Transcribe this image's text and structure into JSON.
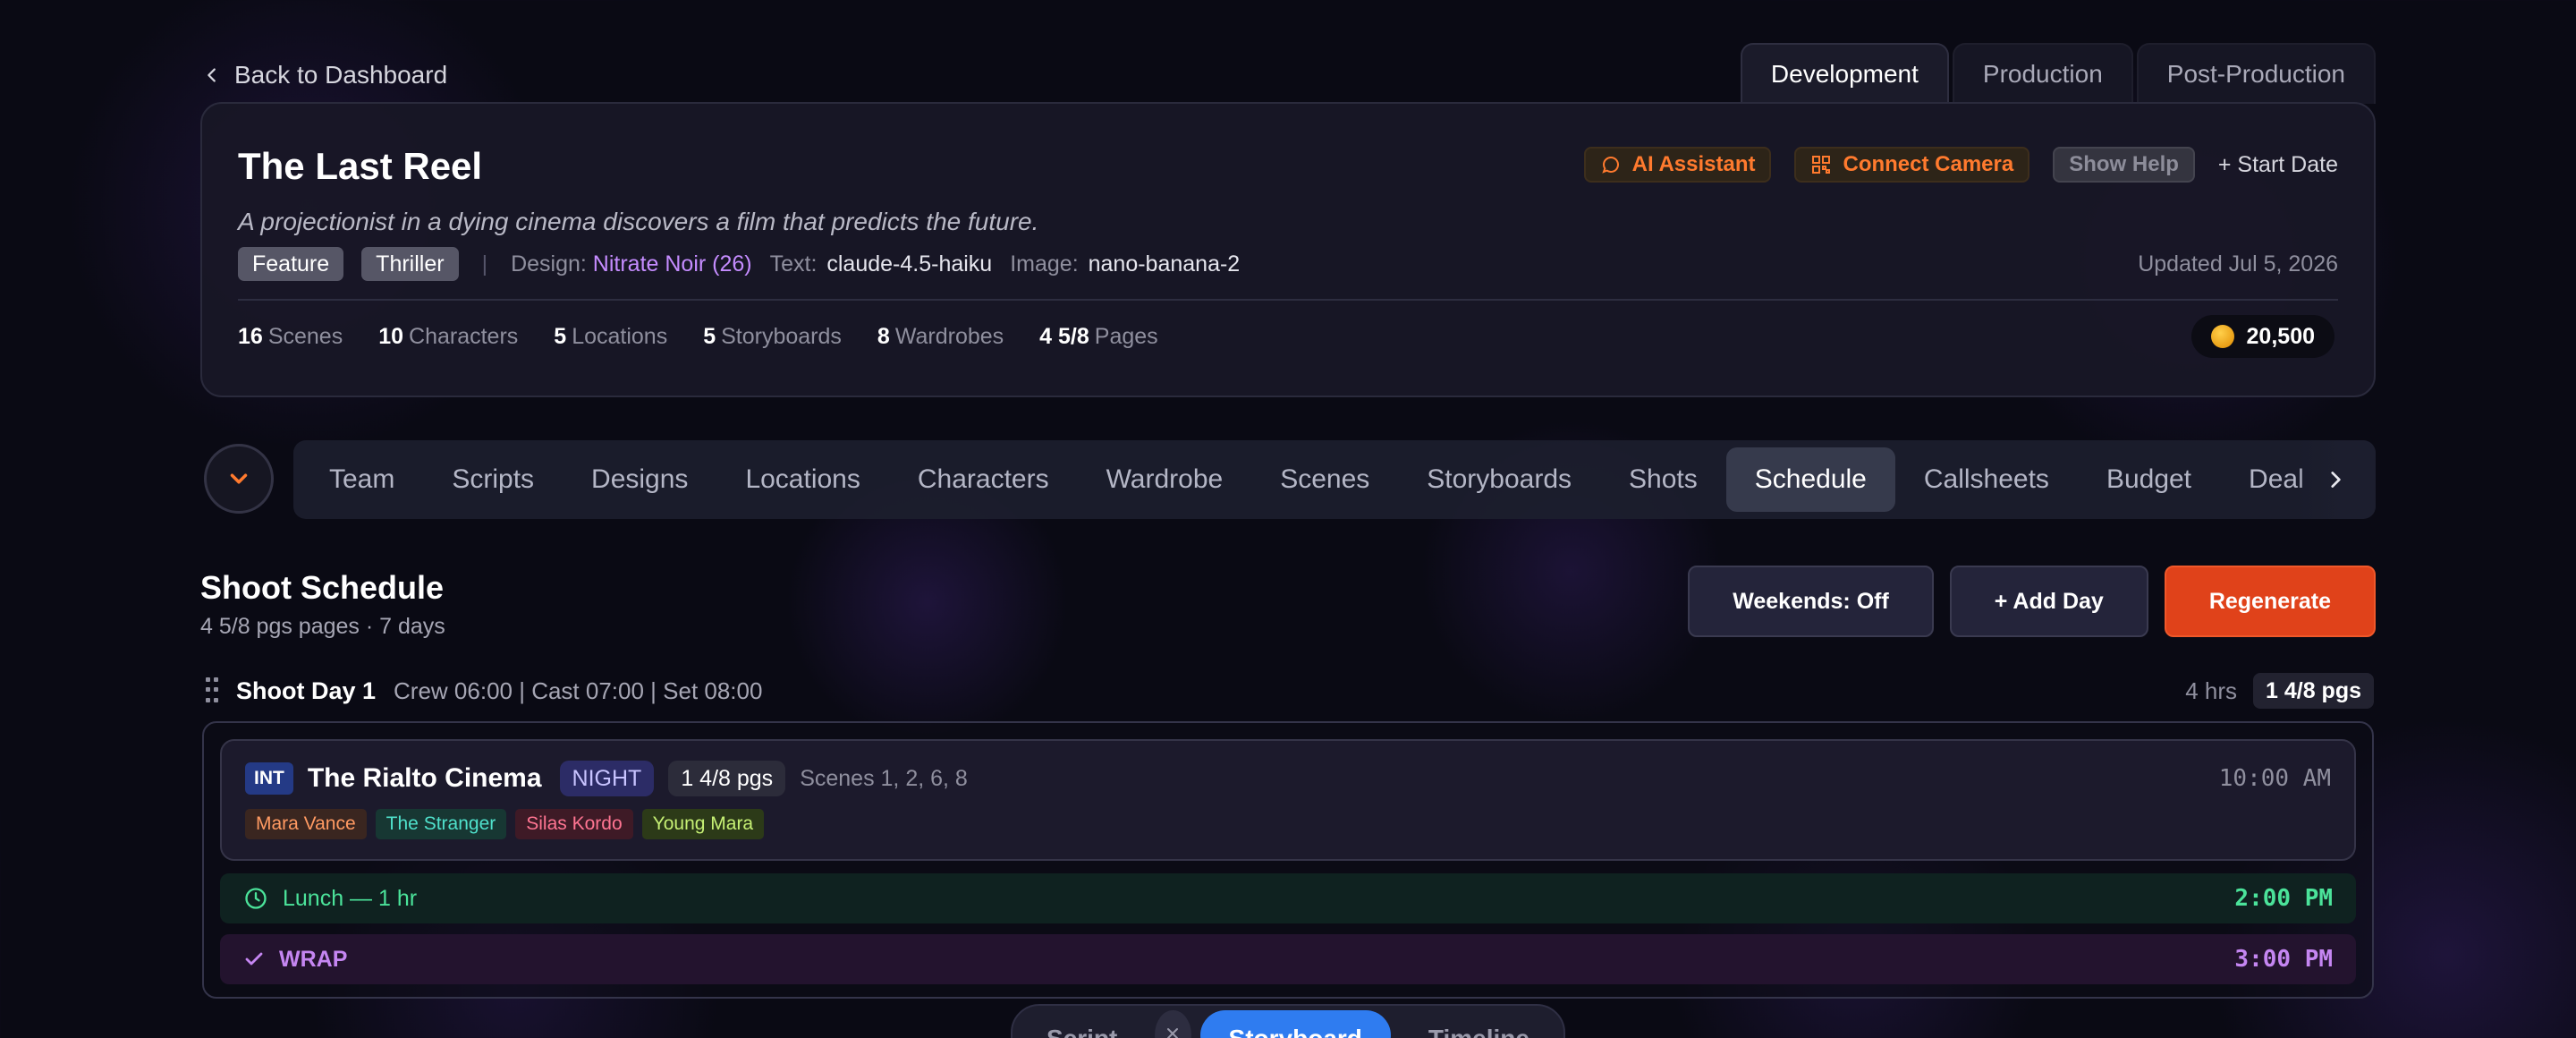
{
  "back": {
    "label": "Back to Dashboard"
  },
  "phase_tabs": [
    {
      "label": "Development",
      "active": true
    },
    {
      "label": "Production",
      "active": false
    },
    {
      "label": "Post-Production",
      "active": false
    }
  ],
  "project": {
    "title": "The Last Reel",
    "logline": "A projectionist in a dying cinema discovers a film that predicts the future.",
    "tags": [
      "Feature",
      "Thriller"
    ],
    "design_label": "Design:",
    "design_value": "Nitrate Noir (26)",
    "text_label": "Text:",
    "text_value": "claude-4.5-haiku",
    "image_label": "Image:",
    "image_value": "nano-banana-2",
    "updated": "Updated Jul 5, 2026",
    "actions": {
      "ai_assistant": "AI Assistant",
      "connect_camera": "Connect Camera",
      "show_help": "Show Help",
      "start_date": "+ Start Date"
    },
    "stats": [
      {
        "value": "16",
        "label": "Scenes"
      },
      {
        "value": "10",
        "label": "Characters"
      },
      {
        "value": "5",
        "label": "Locations"
      },
      {
        "value": "5",
        "label": "Storyboards"
      },
      {
        "value": "8",
        "label": "Wardrobes"
      },
      {
        "value": "4 5/8",
        "label": "Pages"
      }
    ],
    "credits": "20,500"
  },
  "section_nav": [
    {
      "label": "Team"
    },
    {
      "label": "Scripts"
    },
    {
      "label": "Designs"
    },
    {
      "label": "Locations"
    },
    {
      "label": "Characters"
    },
    {
      "label": "Wardrobe"
    },
    {
      "label": "Scenes"
    },
    {
      "label": "Storyboards"
    },
    {
      "label": "Shots"
    },
    {
      "label": "Schedule",
      "active": true
    },
    {
      "label": "Callsheets"
    },
    {
      "label": "Budget"
    },
    {
      "label": "Deal"
    }
  ],
  "schedule": {
    "title": "Shoot Schedule",
    "subtitle": "4 5/8 pgs pages · 7 days",
    "weekends_btn": "Weekends: Off",
    "add_day_btn": "+ Add Day",
    "regenerate_btn": "Regenerate",
    "day": {
      "name": "Shoot Day 1",
      "times": "Crew 06:00 | Cast 07:00 | Set 08:00",
      "hours": "4 hrs",
      "pages": "1 4/8 pgs",
      "scene": {
        "int_ext": "INT",
        "location": "The Rialto Cinema",
        "tod": "NIGHT",
        "pages": "1 4/8 pgs",
        "scenes": "Scenes 1, 2, 6, 8",
        "time": "10:00 AM",
        "cast": [
          "Mara Vance",
          "The Stranger",
          "Silas Kordo",
          "Young Mara"
        ]
      },
      "lunch": {
        "label": "Lunch — 1 hr",
        "time": "2:00 PM"
      },
      "wrap": {
        "label": "WRAP",
        "time": "3:00 PM"
      }
    }
  },
  "view_switch": {
    "items": [
      "Script",
      "Storyboard",
      "Timeline"
    ],
    "active": "Storyboard"
  },
  "colors": {
    "accent_orange": "#e0421a",
    "active_blue": "#2f7cf0",
    "design_purple": "#c58cff",
    "lunch_green": "#4be39a",
    "wrap_purple": "#c586f2"
  }
}
